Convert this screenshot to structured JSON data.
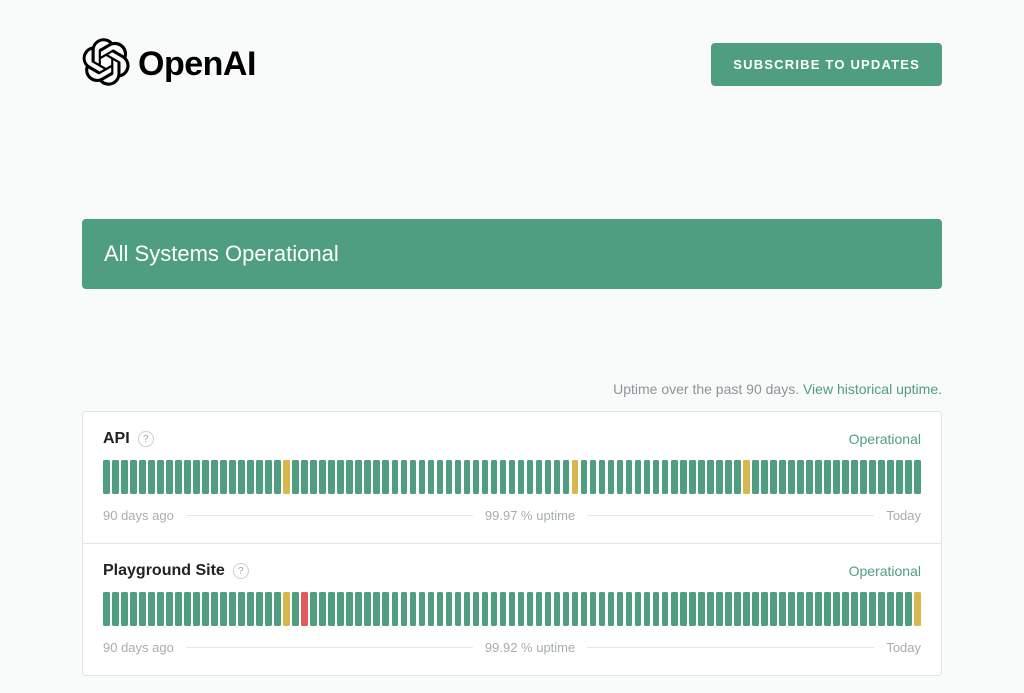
{
  "header": {
    "logo_text": "OpenAI",
    "subscribe_label": "SUBSCRIBE TO UPDATES"
  },
  "status_banner": "All Systems Operational",
  "uptime_heading": {
    "text": "Uptime over the past 90 days. ",
    "link": "View historical uptime."
  },
  "days_ago_label": "90 days ago",
  "today_label": "Today",
  "colors": {
    "operational": "#4f9e7f",
    "degraded": "#d6b84e",
    "outage": "#e05b5b"
  },
  "components": [
    {
      "name": "API",
      "status": "Operational",
      "uptime_text": "99.97 % uptime",
      "bars": "ggggggggggggggggggggygggggggggggggggggggggggggggggggyggggggggggggggggggyggggggggggggggggggg"
    },
    {
      "name": "Playground Site",
      "status": "Operational",
      "uptime_text": "99.92 % uptime",
      "bars": "ggggggggggggggggggggygrgggggggggggggggggggggggggggggggggggggggggggggggggggggggggggggggggggy"
    }
  ]
}
